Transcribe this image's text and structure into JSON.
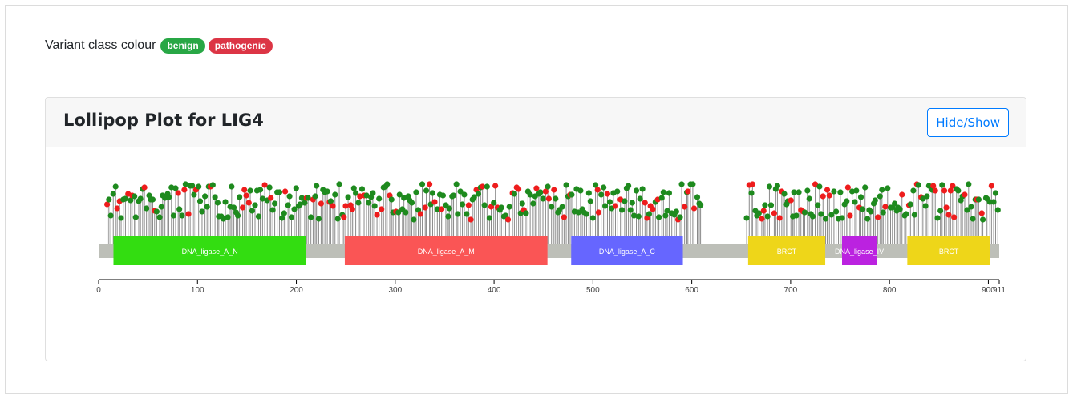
{
  "legend": {
    "label": "Variant class colour",
    "benign": "benign",
    "pathogenic": "pathogenic",
    "benign_color": "#1e8a1e",
    "pathogenic_color": "#ee1c1c"
  },
  "card": {
    "title": "Lollipop Plot for LIG4",
    "toggle_label": "Hide/Show"
  },
  "chart_data": {
    "type": "lollipop",
    "protein_length": 911,
    "x_ticks": [
      0,
      100,
      200,
      300,
      400,
      500,
      600,
      700,
      800,
      900,
      911
    ],
    "x_tick_labels": [
      "0",
      "100",
      "200",
      "300",
      "400",
      "500",
      "600",
      "700",
      "800",
      "900",
      "911"
    ],
    "domains": [
      {
        "name": "DNA_ligase_A_N",
        "start": 15,
        "end": 210,
        "color": "#33dd11"
      },
      {
        "name": "DNA_ligase_A_M",
        "start": 249,
        "end": 454,
        "color": "#fa5555"
      },
      {
        "name": "DNA_ligase_A_C",
        "start": 478,
        "end": 591,
        "color": "#6666ff"
      },
      {
        "name": "BRCT",
        "start": 657,
        "end": 735,
        "color": "#eed619"
      },
      {
        "name": "DNA_ligase_IV",
        "start": 752,
        "end": 787,
        "color": "#bb22e0"
      },
      {
        "name": "BRCT",
        "start": 818,
        "end": 902,
        "color": "#eed619"
      }
    ],
    "variant_regions": [
      [
        8,
        610
      ],
      [
        655,
        911
      ]
    ],
    "pathogenic_fraction": 0.22
  }
}
